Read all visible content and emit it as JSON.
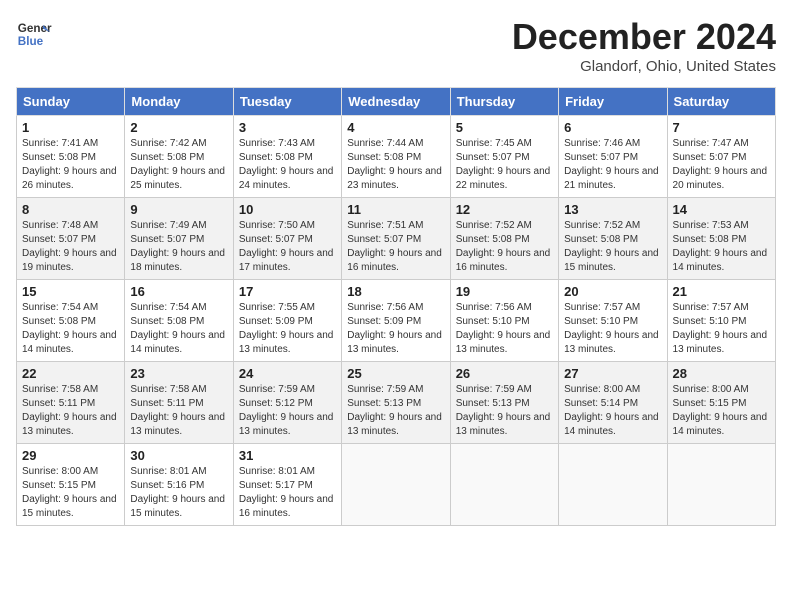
{
  "header": {
    "logo_line1": "General",
    "logo_line2": "Blue",
    "title": "December 2024",
    "subtitle": "Glandorf, Ohio, United States"
  },
  "columns": [
    "Sunday",
    "Monday",
    "Tuesday",
    "Wednesday",
    "Thursday",
    "Friday",
    "Saturday"
  ],
  "weeks": [
    [
      {
        "day": "1",
        "sunrise": "Sunrise: 7:41 AM",
        "sunset": "Sunset: 5:08 PM",
        "daylight": "Daylight: 9 hours and 26 minutes."
      },
      {
        "day": "2",
        "sunrise": "Sunrise: 7:42 AM",
        "sunset": "Sunset: 5:08 PM",
        "daylight": "Daylight: 9 hours and 25 minutes."
      },
      {
        "day": "3",
        "sunrise": "Sunrise: 7:43 AM",
        "sunset": "Sunset: 5:08 PM",
        "daylight": "Daylight: 9 hours and 24 minutes."
      },
      {
        "day": "4",
        "sunrise": "Sunrise: 7:44 AM",
        "sunset": "Sunset: 5:08 PM",
        "daylight": "Daylight: 9 hours and 23 minutes."
      },
      {
        "day": "5",
        "sunrise": "Sunrise: 7:45 AM",
        "sunset": "Sunset: 5:07 PM",
        "daylight": "Daylight: 9 hours and 22 minutes."
      },
      {
        "day": "6",
        "sunrise": "Sunrise: 7:46 AM",
        "sunset": "Sunset: 5:07 PM",
        "daylight": "Daylight: 9 hours and 21 minutes."
      },
      {
        "day": "7",
        "sunrise": "Sunrise: 7:47 AM",
        "sunset": "Sunset: 5:07 PM",
        "daylight": "Daylight: 9 hours and 20 minutes."
      }
    ],
    [
      {
        "day": "8",
        "sunrise": "Sunrise: 7:48 AM",
        "sunset": "Sunset: 5:07 PM",
        "daylight": "Daylight: 9 hours and 19 minutes."
      },
      {
        "day": "9",
        "sunrise": "Sunrise: 7:49 AM",
        "sunset": "Sunset: 5:07 PM",
        "daylight": "Daylight: 9 hours and 18 minutes."
      },
      {
        "day": "10",
        "sunrise": "Sunrise: 7:50 AM",
        "sunset": "Sunset: 5:07 PM",
        "daylight": "Daylight: 9 hours and 17 minutes."
      },
      {
        "day": "11",
        "sunrise": "Sunrise: 7:51 AM",
        "sunset": "Sunset: 5:07 PM",
        "daylight": "Daylight: 9 hours and 16 minutes."
      },
      {
        "day": "12",
        "sunrise": "Sunrise: 7:52 AM",
        "sunset": "Sunset: 5:08 PM",
        "daylight": "Daylight: 9 hours and 16 minutes."
      },
      {
        "day": "13",
        "sunrise": "Sunrise: 7:52 AM",
        "sunset": "Sunset: 5:08 PM",
        "daylight": "Daylight: 9 hours and 15 minutes."
      },
      {
        "day": "14",
        "sunrise": "Sunrise: 7:53 AM",
        "sunset": "Sunset: 5:08 PM",
        "daylight": "Daylight: 9 hours and 14 minutes."
      }
    ],
    [
      {
        "day": "15",
        "sunrise": "Sunrise: 7:54 AM",
        "sunset": "Sunset: 5:08 PM",
        "daylight": "Daylight: 9 hours and 14 minutes."
      },
      {
        "day": "16",
        "sunrise": "Sunrise: 7:54 AM",
        "sunset": "Sunset: 5:08 PM",
        "daylight": "Daylight: 9 hours and 14 minutes."
      },
      {
        "day": "17",
        "sunrise": "Sunrise: 7:55 AM",
        "sunset": "Sunset: 5:09 PM",
        "daylight": "Daylight: 9 hours and 13 minutes."
      },
      {
        "day": "18",
        "sunrise": "Sunrise: 7:56 AM",
        "sunset": "Sunset: 5:09 PM",
        "daylight": "Daylight: 9 hours and 13 minutes."
      },
      {
        "day": "19",
        "sunrise": "Sunrise: 7:56 AM",
        "sunset": "Sunset: 5:10 PM",
        "daylight": "Daylight: 9 hours and 13 minutes."
      },
      {
        "day": "20",
        "sunrise": "Sunrise: 7:57 AM",
        "sunset": "Sunset: 5:10 PM",
        "daylight": "Daylight: 9 hours and 13 minutes."
      },
      {
        "day": "21",
        "sunrise": "Sunrise: 7:57 AM",
        "sunset": "Sunset: 5:10 PM",
        "daylight": "Daylight: 9 hours and 13 minutes."
      }
    ],
    [
      {
        "day": "22",
        "sunrise": "Sunrise: 7:58 AM",
        "sunset": "Sunset: 5:11 PM",
        "daylight": "Daylight: 9 hours and 13 minutes."
      },
      {
        "day": "23",
        "sunrise": "Sunrise: 7:58 AM",
        "sunset": "Sunset: 5:11 PM",
        "daylight": "Daylight: 9 hours and 13 minutes."
      },
      {
        "day": "24",
        "sunrise": "Sunrise: 7:59 AM",
        "sunset": "Sunset: 5:12 PM",
        "daylight": "Daylight: 9 hours and 13 minutes."
      },
      {
        "day": "25",
        "sunrise": "Sunrise: 7:59 AM",
        "sunset": "Sunset: 5:13 PM",
        "daylight": "Daylight: 9 hours and 13 minutes."
      },
      {
        "day": "26",
        "sunrise": "Sunrise: 7:59 AM",
        "sunset": "Sunset: 5:13 PM",
        "daylight": "Daylight: 9 hours and 13 minutes."
      },
      {
        "day": "27",
        "sunrise": "Sunrise: 8:00 AM",
        "sunset": "Sunset: 5:14 PM",
        "daylight": "Daylight: 9 hours and 14 minutes."
      },
      {
        "day": "28",
        "sunrise": "Sunrise: 8:00 AM",
        "sunset": "Sunset: 5:15 PM",
        "daylight": "Daylight: 9 hours and 14 minutes."
      }
    ],
    [
      {
        "day": "29",
        "sunrise": "Sunrise: 8:00 AM",
        "sunset": "Sunset: 5:15 PM",
        "daylight": "Daylight: 9 hours and 15 minutes."
      },
      {
        "day": "30",
        "sunrise": "Sunrise: 8:01 AM",
        "sunset": "Sunset: 5:16 PM",
        "daylight": "Daylight: 9 hours and 15 minutes."
      },
      {
        "day": "31",
        "sunrise": "Sunrise: 8:01 AM",
        "sunset": "Sunset: 5:17 PM",
        "daylight": "Daylight: 9 hours and 16 minutes."
      },
      null,
      null,
      null,
      null
    ]
  ]
}
